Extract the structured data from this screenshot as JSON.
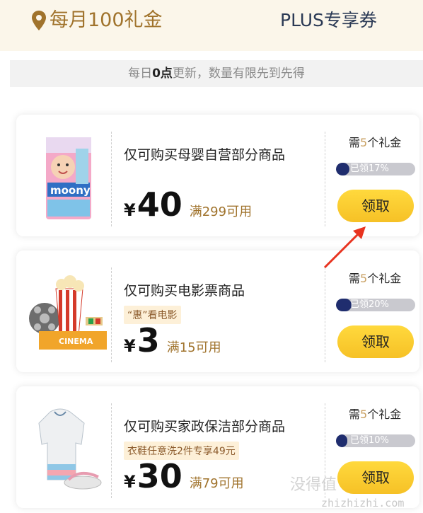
{
  "header": {
    "title": "每月100礼金",
    "plus_tab": "PLUS专享券",
    "accent": "#a0732c"
  },
  "notice": {
    "prefix": "每日",
    "bold": "0点",
    "suffix": "更新，数量有限先到先得"
  },
  "coupons": [
    {
      "condition": "仅可购买母婴自营部分商品",
      "tag": "",
      "currency": "¥",
      "amount": "40",
      "minimum": "满299可用",
      "need_prefix": "需",
      "need_count": "5",
      "need_suffix": "个礼金",
      "claimed_text": "已领17%",
      "claimed_fraction": 0.17,
      "button": "领取",
      "image_icon": "diaper-package-icon"
    },
    {
      "condition": "仅可购买电影票商品",
      "tag": "“惠”看电影",
      "currency": "¥",
      "amount": "3",
      "minimum": "满15可用",
      "need_prefix": "需",
      "need_count": "5",
      "need_suffix": "个礼金",
      "claimed_text": "已领20%",
      "claimed_fraction": 0.2,
      "button": "领取",
      "image_icon": "cinema-popcorn-icon"
    },
    {
      "condition": "仅可购买家政保洁部分商品",
      "tag": "衣鞋任意洗2件专享49元",
      "currency": "¥",
      "amount": "30",
      "minimum": "满79可用",
      "need_prefix": "需",
      "need_count": "5",
      "need_suffix": "个礼金",
      "claimed_text": "已领10%",
      "claimed_fraction": 0.1,
      "button": "领取",
      "image_icon": "jacket-shoes-icon"
    }
  ],
  "watermark": {
    "text": "没得值",
    "sub": "zhizhizhi.com"
  }
}
